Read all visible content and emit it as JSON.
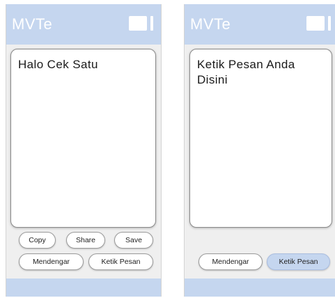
{
  "screens": [
    {
      "app_title": "MVTe",
      "message_text": "Halo Cek Satu",
      "buttons": {
        "copy": "Copy",
        "share": "Share",
        "save": "Save",
        "mendengar": "Mendengar",
        "ketik_pesan": "Ketik Pesan"
      }
    },
    {
      "app_title": "MVTe",
      "message_text": "Ketik Pesan Anda Disini",
      "buttons": {
        "mendengar": "Mendengar",
        "ketik_pesan": "Ketik Pesan"
      },
      "active_button": "ketik_pesan"
    }
  ],
  "colors": {
    "header_background": "#c5d6ef",
    "screen_background": "#efefef",
    "active_button_background": "#c5d6ef"
  },
  "icons": {
    "header_menu": "menu-icon"
  }
}
